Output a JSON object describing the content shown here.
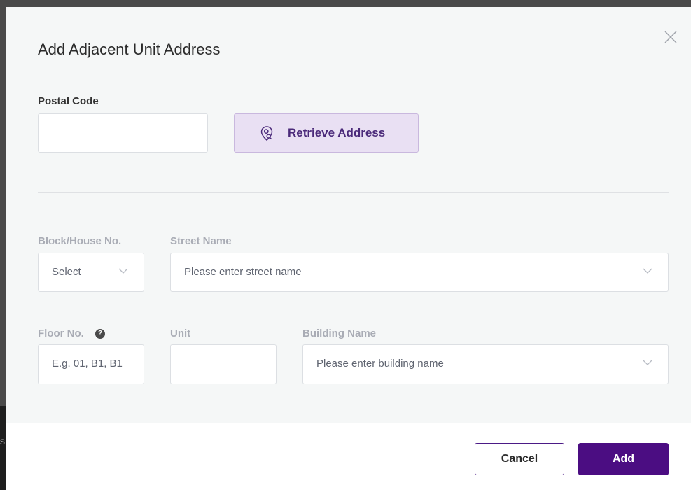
{
  "backdrop": {
    "edge_letter": "s"
  },
  "dialog": {
    "title": "Add Adjacent Unit Address",
    "postal_code": {
      "label": "Postal Code",
      "value": ""
    },
    "retrieve_button": {
      "label": "Retrieve Address",
      "icon": "location-search-icon"
    },
    "block": {
      "label": "Block/House No.",
      "value": "Select"
    },
    "street": {
      "label": "Street Name",
      "placeholder": "Please enter street name"
    },
    "floor": {
      "label": "Floor No.",
      "placeholder": "E.g. 01, B1, B1",
      "help_icon": "?"
    },
    "unit": {
      "label": "Unit",
      "value": ""
    },
    "building": {
      "label": "Building Name",
      "placeholder": "Please enter building name"
    },
    "cancel_label": "Cancel",
    "add_label": "Add"
  },
  "colors": {
    "accent": "#4b0d82",
    "retrieve_bg": "#e9e0f3",
    "dialog_bg": "#f5f7f7",
    "muted_label": "#a9acb5"
  }
}
